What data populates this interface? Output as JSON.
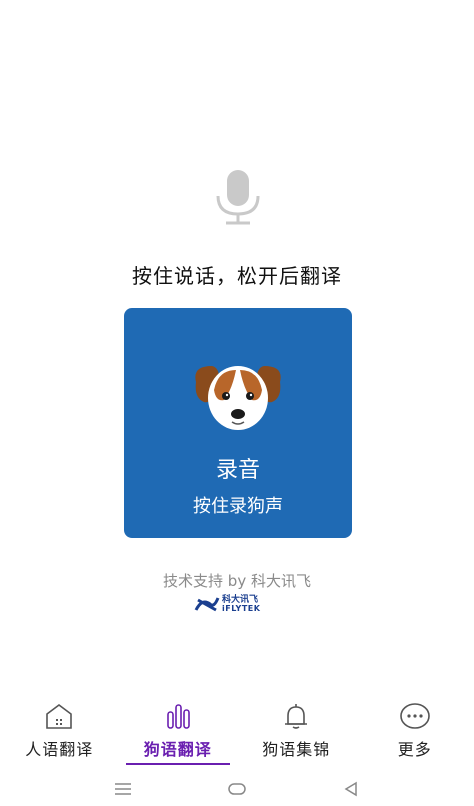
{
  "prompt_text": "按住说话，松开后翻译",
  "record_card": {
    "title": "录音",
    "subtitle": "按住录狗声"
  },
  "powered_by": "技术支持 by 科大讯飞",
  "brand_logo": {
    "cn": "科大讯飞",
    "en": "iFLYTEK"
  },
  "bottom_nav": [
    {
      "label": "人语翻译",
      "icon": "house-icon",
      "active": false
    },
    {
      "label": "狗语翻译",
      "icon": "sound-bars-icon",
      "active": true
    },
    {
      "label": "狗语集锦",
      "icon": "bell-icon",
      "active": false
    },
    {
      "label": "更多",
      "icon": "more-dots-icon",
      "active": false
    }
  ],
  "colors": {
    "card_blue": "#1f6ab4",
    "active_purple": "#6a1fb0"
  }
}
